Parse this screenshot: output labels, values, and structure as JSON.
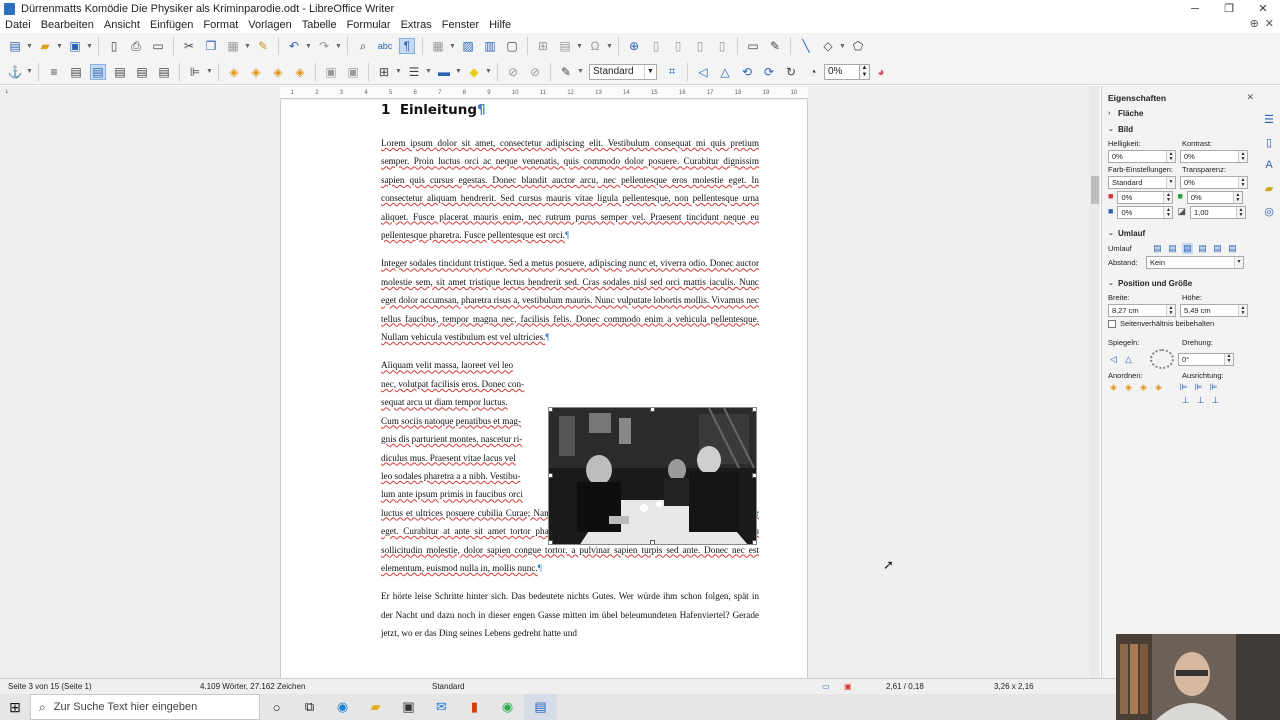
{
  "window": {
    "title": "Dürrenmatts Komödie Die Physiker als Kriminparodie.odt - LibreOffice Writer",
    "buttons": [
      "─",
      "❐",
      "✕"
    ]
  },
  "menubar": {
    "items": [
      "Datei",
      "Bearbeiten",
      "Ansicht",
      "Einfügen",
      "Format",
      "Vorlagen",
      "Tabelle",
      "Formular",
      "Extras",
      "Fenster",
      "Hilfe"
    ]
  },
  "toolbar2": {
    "paragraph_style": "Standard",
    "zoom": "0%"
  },
  "ruler": {
    "ticks": [
      "1",
      "2",
      "3",
      "4",
      "5",
      "6",
      "7",
      "8",
      "9",
      "10",
      "11",
      "12",
      "13",
      "14",
      "15",
      "16",
      "17",
      "18",
      "19",
      "10"
    ]
  },
  "document": {
    "heading_number": "1",
    "heading_text": "Einleitung",
    "paragraph1": "Lorem ipsum dolor sit amet, consectetur adipiscing elit. Vestibulum consequat mi quis pretium semper. Proin luctus orci ac neque venenatis, quis commodo dolor posuere. Curabitur dignissim sapien quis cursus egestas. Donec blandit auctor arcu, nec pellentesque eros molestie eget. In consectetur aliquam hendrerit. Sed cursus mauris vitae ligula pellentesque, non pellentesque urna aliquet. Fusce placerat mauris enim, nec rutrum purus semper vel. Praesent tincidunt neque eu pellentesque pharetra. Fusce pellentesque est orci.",
    "paragraph2": "Integer sodales tincidunt tristique. Sed a metus posuere, adipiscing nunc et, viverra odio. Donec auctor molestie sem, sit amet tristique lectus hendrerit sed. Cras sodales nisl sed orci mattis iaculis. Nunc eget dolor accumsan, pharetra risus a, vestibulum mauris. Nunc vulputate lobortis mollis. Vivamus nec tellus faucibus, tempor magna nec, facilisis felis. Donec commodo enim a vehicula pellentesque. Nullam vehicula vestibulum est vel ultricies.",
    "paragraph3_wrapped": [
      "Aliquam velit massa, laoreet vel leo",
      "nec, volutpat facilisis eros. Donec con-",
      "sequat arcu ut diam tempor luctus.",
      "Cum sociis natoque penatibus et mag-",
      "gnis dis parturient montes, nascetur ri-",
      "diculus mus. Praesent vitae lacus vel",
      "leo sodales pharetra a a nibh. Vestibu-",
      "lum ante ipsum primis in faucibus orci"
    ],
    "paragraph3_rest": "luctus et ultrices posuere cubilia Curae; Nam luctus tempus nibh, fringilla dictum augue consectetur eget. Curabitur at ante sit amet tortor pharetra molestie eu nec ante. Mauris tincidunt, nibh eu sollicitudin molestie, dolor sapien congue tortor, a pulvinar sapien turpis sed ante. Donec nec est elementum, euismod nulla in, mollis nunc.",
    "paragraph4": "Er hörte leise Schritte hinter sich. Das bedeutete nichts Gutes. Wer würde ihm schon folgen, spät in der Nacht und dazu noch in dieser engen Gasse mitten im übel beleumundeten Hafenviertel? Gerade jetzt, wo er das Ding seines Lebens gedreht hatte und",
    "pilcrow": "¶"
  },
  "sidebar": {
    "title": "Eigenschaften",
    "sections": {
      "flaeche": "Fläche",
      "bild": "Bild",
      "umlauf": "Umlauf",
      "position": "Position und Größe"
    },
    "labels": {
      "helligkeit": "Helligkeit:",
      "kontrast": "Kontrast:",
      "farb": "Farb-Einstellungen:",
      "transparenz": "Transparenz:",
      "umlauf": "Umlauf",
      "abstand": "Abstand:",
      "breite": "Breite:",
      "hoehe": "Höhe:",
      "seitenverh": "Seitenverhältnis beibehalten",
      "spiegeln": "Spiegeln:",
      "drehung": "Drehung:",
      "anordnen": "Anordnen:",
      "ausrichtung": "Ausrichtung:"
    },
    "values": {
      "helligkeit": "0%",
      "kontrast": "0%",
      "farb": "Standard",
      "transparenz": "0%",
      "rot": "0%",
      "gruen": "0%",
      "blau": "0%",
      "gamma": "1,00",
      "abstand": "Kein",
      "breite": "8,27 cm",
      "hoehe": "5,49 cm",
      "drehung": "0°"
    }
  },
  "statusbar": {
    "page": "Seite 3 von 15 (Seite 1)",
    "words": "4.109 Wörter, 27.162 Zeichen",
    "style": "Standard",
    "position": "2,61 / 0,18",
    "size": "3,26 x 2,16"
  },
  "taskbar": {
    "search_placeholder": "Zur Suche Text hier eingeben"
  }
}
